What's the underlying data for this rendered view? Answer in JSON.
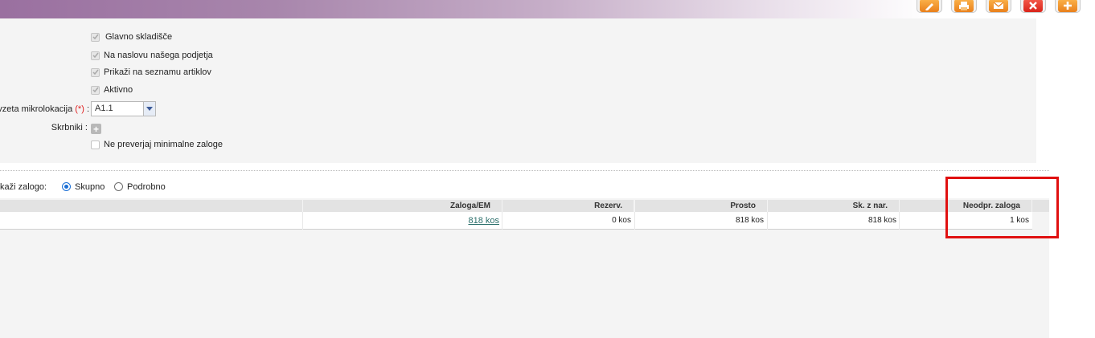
{
  "toolbar": {
    "buttons": [
      {
        "name": "edit",
        "icon": "pencil-icon"
      },
      {
        "name": "print",
        "icon": "printer-icon"
      },
      {
        "name": "email",
        "icon": "envelope-icon"
      },
      {
        "name": "close",
        "icon": "close-icon"
      },
      {
        "name": "add",
        "icon": "plus-icon"
      }
    ]
  },
  "form": {
    "checkbox_main_warehouse": "Glavno skladišče",
    "checkbox_company_address": "Na naslovu našega podjetja",
    "checkbox_show_in_list": "Prikaži na seznamu artiklov",
    "checkbox_active": "Aktivno",
    "default_microlocation_label": "vzeta mikrolokacija",
    "required_marker": "(*)",
    "label_colon": ":",
    "default_microlocation_value": "A1.1",
    "custodians_label": "Skrbniki :",
    "checkbox_no_min_stock": "Ne preverjaj minimalne zaloge"
  },
  "stock_view": {
    "label": "kaži zalogo:",
    "option_total": "Skupno",
    "option_detailed": "Podrobno",
    "selected": "Skupno"
  },
  "table": {
    "headers": {
      "stock": "Zaloga/EM",
      "reserved": "Rezerv.",
      "free": "Prosto",
      "from_order": "Sk. z nar.",
      "unresolved": "Neodpr. zaloga"
    },
    "row": {
      "stock": "818 kos",
      "reserved": "0 kos",
      "free": "818 kos",
      "from_order": "818 kos",
      "unresolved": "1 kos"
    }
  },
  "colors": {
    "accent_purple": "#9a70a0",
    "toolbar_orange": "#e9801c",
    "toolbar_red": "#d9241a",
    "link_teal": "#2a6e6a",
    "highlight_red": "#e01010"
  }
}
